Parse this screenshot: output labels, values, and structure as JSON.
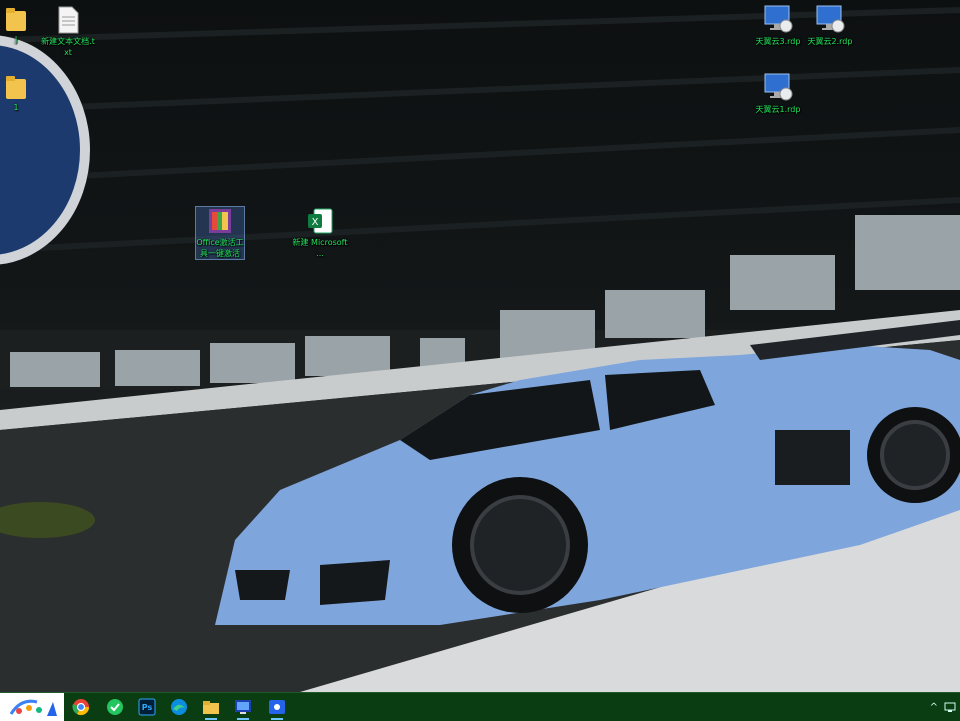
{
  "desktop": {
    "icons": [
      {
        "id": "folder-1",
        "label": "J",
        "type": "folder"
      },
      {
        "id": "txt-1",
        "label": "新建文本文档.txt",
        "type": "text"
      },
      {
        "id": "folder-2",
        "label": "1",
        "type": "folder"
      },
      {
        "id": "office-tool",
        "label": "Office激活工具一键激活",
        "type": "installer"
      },
      {
        "id": "excel-1",
        "label": "新建 Microsoft ...",
        "type": "excel"
      },
      {
        "id": "rdp-3",
        "label": "天翼云3.rdp",
        "type": "rdp"
      },
      {
        "id": "rdp-2",
        "label": "天翼云2.rdp",
        "type": "rdp"
      },
      {
        "id": "rdp-1",
        "label": "天翼云1.rdp",
        "type": "rdp"
      }
    ]
  },
  "taskbar": {
    "apps": [
      {
        "name": "chrome-icon"
      },
      {
        "name": "green-app-icon"
      },
      {
        "name": "photoshop-icon",
        "text": "Ps"
      },
      {
        "name": "edge-icon"
      },
      {
        "name": "file-explorer-icon"
      },
      {
        "name": "remote-desktop-icon"
      },
      {
        "name": "screen-recorder-icon"
      }
    ],
    "tray_chevron": "^"
  },
  "colors": {
    "taskbar": "#0a3d12",
    "icon_label": "#22e05a",
    "car_blue": "#7fa6dc"
  }
}
